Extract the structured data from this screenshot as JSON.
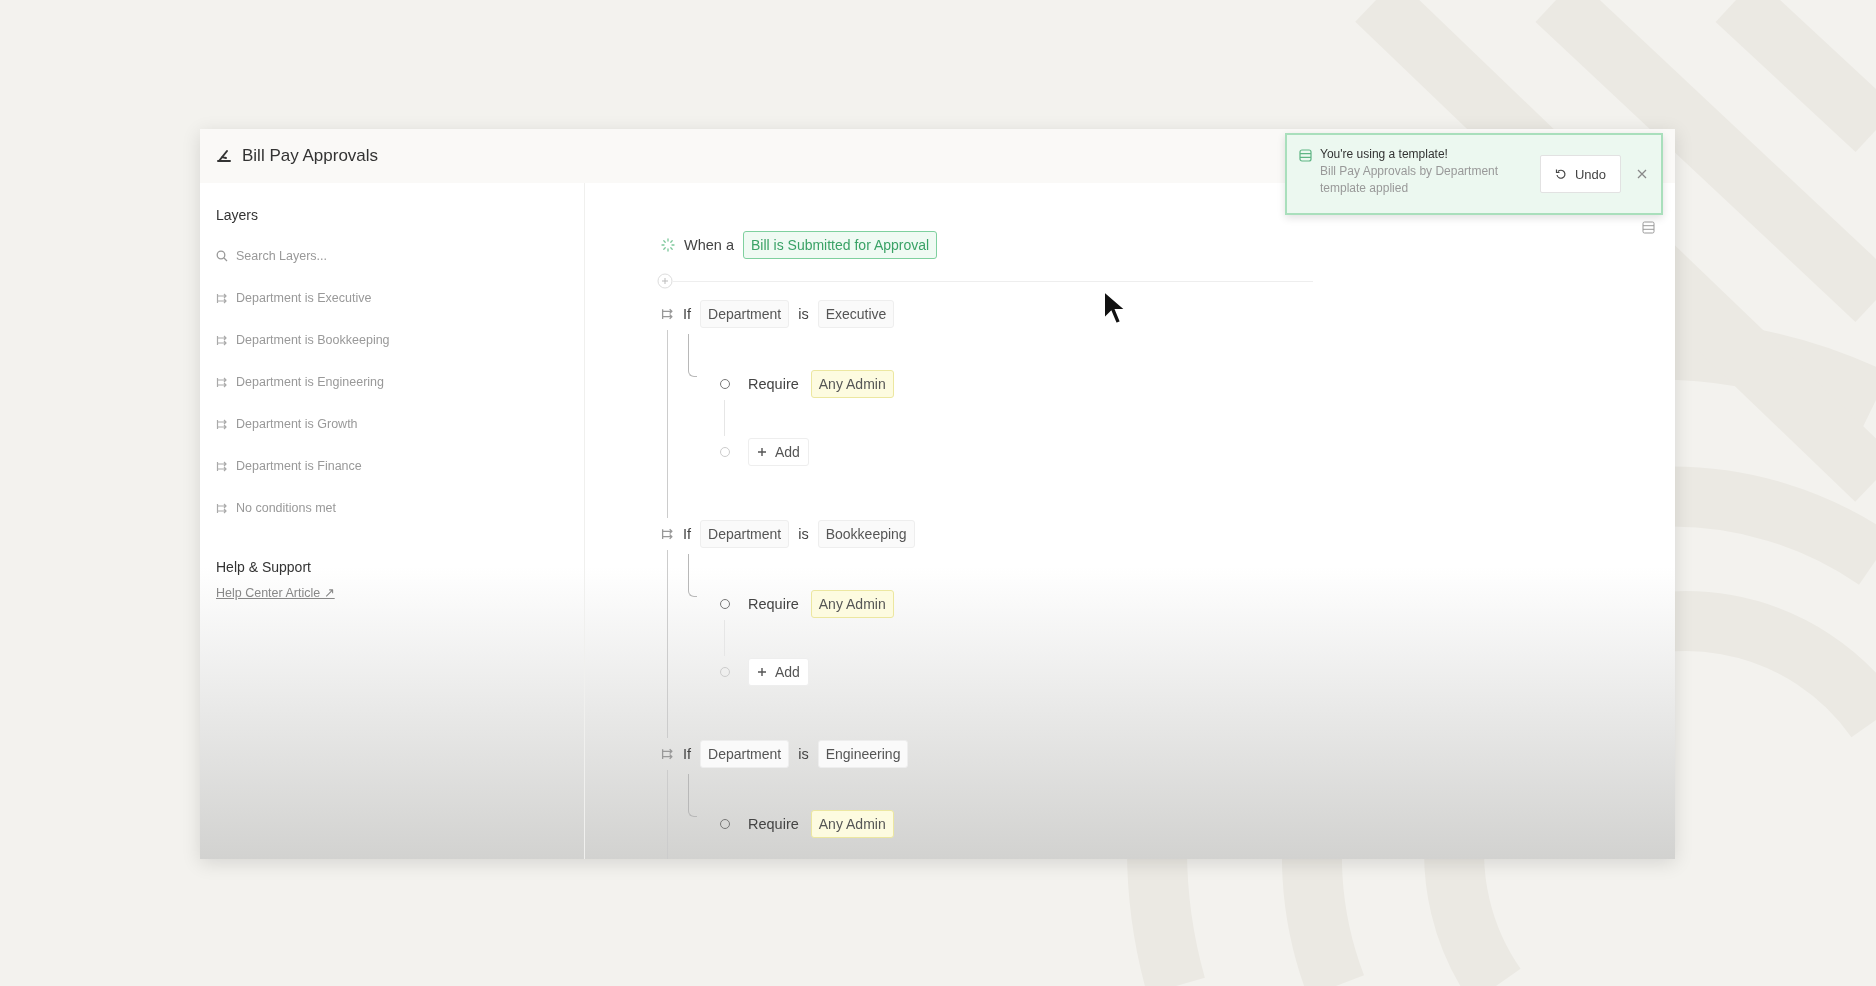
{
  "window": {
    "title": "Bill Pay Approvals"
  },
  "sidebar": {
    "heading": "Layers",
    "search": {
      "placeholder": "Search Layers..."
    },
    "layers": [
      {
        "label": "Department is Executive"
      },
      {
        "label": "Department is Bookkeeping"
      },
      {
        "label": "Department is Engineering"
      },
      {
        "label": "Department is Growth"
      },
      {
        "label": "Department is Finance"
      },
      {
        "label": "No conditions met"
      }
    ],
    "help": {
      "heading": "Help & Support",
      "link": "Help Center Article ↗"
    }
  },
  "trigger": {
    "prefix": "When a",
    "event": "Bill is Submitted for Approval"
  },
  "branches": [
    {
      "keyword": "If",
      "field": "Department",
      "operator": "is",
      "value": "Executive",
      "steps": [
        {
          "kind": "require",
          "label": "Require",
          "approver": "Any Admin"
        },
        {
          "kind": "add",
          "label": "Add"
        }
      ]
    },
    {
      "keyword": "If",
      "field": "Department",
      "operator": "is",
      "value": "Bookkeeping",
      "steps": [
        {
          "kind": "require",
          "label": "Require",
          "approver": "Any Admin"
        },
        {
          "kind": "add",
          "label": "Add"
        }
      ]
    },
    {
      "keyword": "If",
      "field": "Department",
      "operator": "is",
      "value": "Engineering",
      "steps": [
        {
          "kind": "require",
          "label": "Require",
          "approver": "Any Admin"
        }
      ]
    }
  ],
  "toast": {
    "title": "You're using a template!",
    "message": "Bill Pay Approvals by Department template applied",
    "undo": "Undo"
  }
}
